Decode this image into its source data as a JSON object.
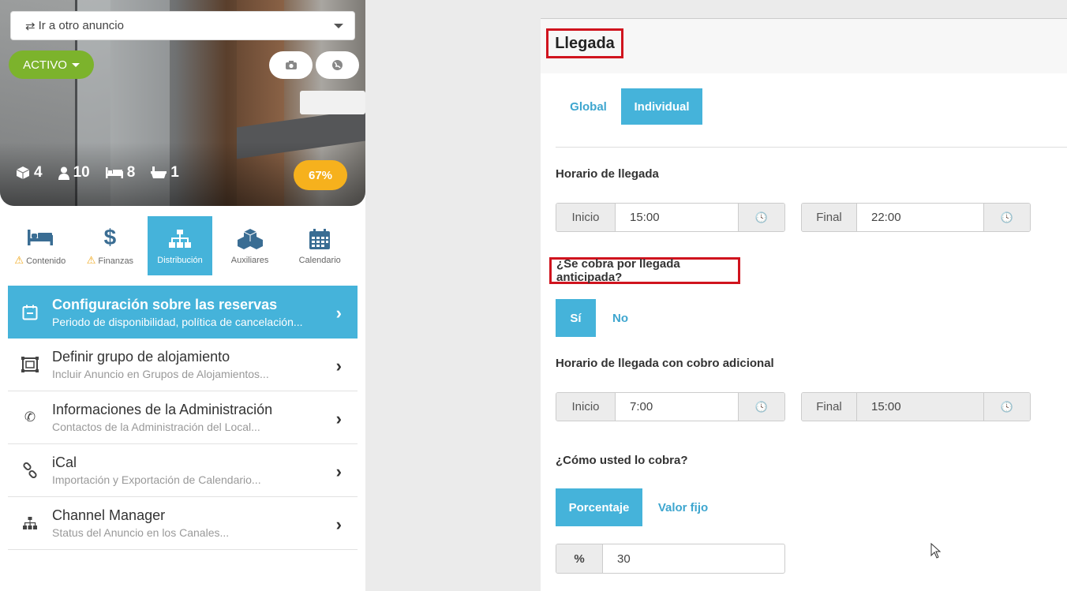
{
  "left": {
    "goto": {
      "icon": "swap-icon",
      "label": "Ir a otro anuncio"
    },
    "status_button": "ACTIVO",
    "stats": [
      {
        "icon": "cube-icon",
        "value": "4"
      },
      {
        "icon": "user-icon",
        "value": "10"
      },
      {
        "icon": "bed-icon",
        "value": "8"
      },
      {
        "icon": "bathtub-icon",
        "value": "1"
      }
    ],
    "completion": "67%",
    "nav": [
      {
        "label": "Contenido",
        "warning": true
      },
      {
        "label": "Finanzas",
        "warning": true
      },
      {
        "label": "Distribución",
        "active": true
      },
      {
        "label": "Auxiliares"
      },
      {
        "label": "Calendario"
      }
    ],
    "menu": [
      {
        "title": "Configuración sobre las reservas",
        "subtitle": "Periodo de disponibilidad, política de cancelación...",
        "active": true
      },
      {
        "title": "Definir grupo de alojamiento",
        "subtitle": "Incluir Anuncio en Grupos de Alojamientos..."
      },
      {
        "title": "Informaciones de la Administración",
        "subtitle": "Contactos de la Administración del Local..."
      },
      {
        "title": "iCal",
        "subtitle": "Importación y Exportación de Calendario..."
      },
      {
        "title": "Channel Manager",
        "subtitle": "Status del Anuncio en los Canales..."
      }
    ]
  },
  "right": {
    "title": "Llegada",
    "scope_tabs": {
      "global": "Global",
      "individual": "Individual"
    },
    "arrival_label": "Horario de llegada",
    "arrival": {
      "start_label": "Inicio",
      "start_value": "15:00",
      "end_label": "Final",
      "end_value": "22:00"
    },
    "early_question": "¿Se cobra por llegada anticipada?",
    "early_options": {
      "yes": "Sí",
      "no": "No"
    },
    "extra_label": "Horario de llegada con cobro adicional",
    "extra": {
      "start_label": "Inicio",
      "start_value": "7:00",
      "end_label": "Final",
      "end_value": "15:00"
    },
    "how_label": "¿Cómo usted lo cobra?",
    "how_options": {
      "percent": "Porcentaje",
      "fixed": "Valor fijo"
    },
    "percent_symbol": "%",
    "percent_value": "30"
  }
}
